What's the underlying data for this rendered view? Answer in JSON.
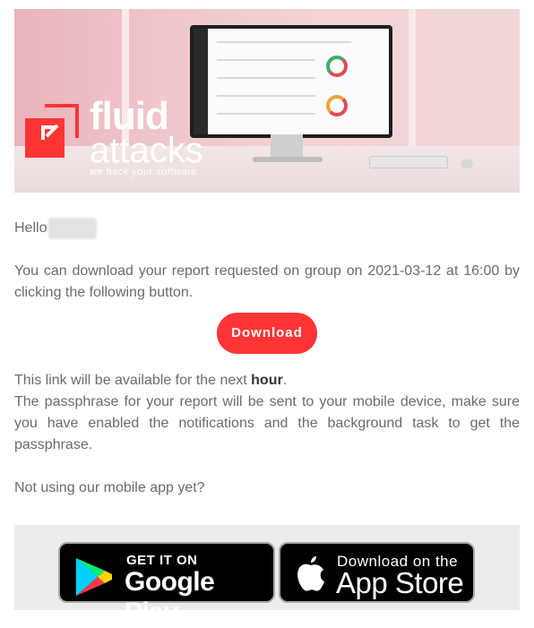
{
  "banner": {
    "logo_line1": "fluid",
    "logo_line2": "attacks",
    "logo_tagline": "we hack your software",
    "accent_color": "#ff3435"
  },
  "email": {
    "greeting": "Hello",
    "paragraph1": "You can download your report requested on group on 2021-03-12 at 16:00 by clicking the following button.",
    "download_button": "Download",
    "availability_prefix": "This link will be available for the next",
    "availability_strong": "hour",
    "availability_suffix": ".",
    "passphrase_note": "The passphrase for your report will be sent to your mobile device, make sure you have enabled the notifications and the background task to get the passphrase.",
    "app_prompt": "Not using our mobile app yet?"
  },
  "stores": {
    "google_small": "GET IT ON",
    "google_big": "Google Play",
    "apple_small": "Download on the",
    "apple_big": "App Store"
  }
}
